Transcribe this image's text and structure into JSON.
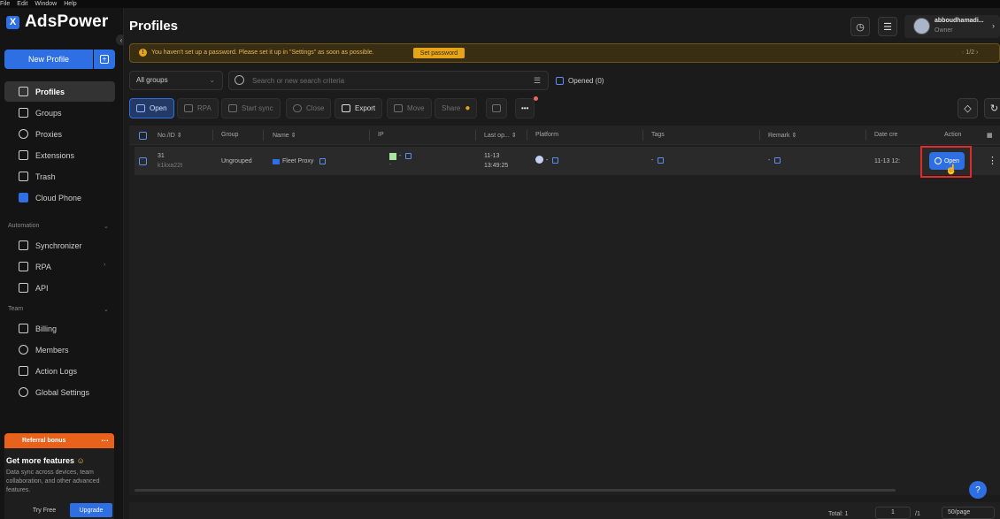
{
  "menubar": [
    "File",
    "Edit",
    "Window",
    "Help"
  ],
  "app": {
    "name": "AdsPower",
    "logo_mark": "X"
  },
  "sidebar": {
    "new_profile": "New Profile",
    "items": [
      {
        "label": "Profiles",
        "icon": "profiles-icon",
        "active": true
      },
      {
        "label": "Groups",
        "icon": "groups-icon"
      },
      {
        "label": "Proxies",
        "icon": "proxies-icon"
      },
      {
        "label": "Extensions",
        "icon": "extensions-icon"
      },
      {
        "label": "Trash",
        "icon": "trash-icon"
      },
      {
        "label": "Cloud Phone",
        "icon": "cloud-phone-icon"
      }
    ],
    "automation_label": "Automation",
    "automation_items": [
      {
        "label": "Synchronizer",
        "icon": "synchronizer-icon"
      },
      {
        "label": "RPA",
        "icon": "rpa-icon"
      },
      {
        "label": "API",
        "icon": "api-icon"
      }
    ],
    "team_label": "Team",
    "team_items": [
      {
        "label": "Billing",
        "icon": "billing-icon"
      },
      {
        "label": "Members",
        "icon": "members-icon"
      },
      {
        "label": "Action Logs",
        "icon": "action-logs-icon"
      },
      {
        "label": "Global Settings",
        "icon": "global-settings-icon"
      }
    ],
    "referral": "Referral bonus",
    "promo_title": "Get more features",
    "promo_desc": "Data sync across devices, team collaboration, and other advanced features.",
    "try_free": "Try Free",
    "upgrade": "Upgrade"
  },
  "header": {
    "title": "Profiles",
    "user_name": "abboudhamadi...",
    "user_role": "Owner"
  },
  "banner": {
    "text": "You haven't set up a password. Please set it up in \"Settings\" as soon as possible.",
    "button": "Set password",
    "page": "1/2"
  },
  "filters": {
    "group_select": "All groups",
    "search_placeholder": "Search or new search criteria",
    "opened_label": "Opened (0)"
  },
  "toolbar": {
    "open": "Open",
    "rpa": "RPA",
    "start_sync": "Start sync",
    "close": "Close",
    "export": "Export",
    "move": "Move",
    "share": "Share",
    "more": "•••"
  },
  "table": {
    "columns": [
      "No./ID ⇕",
      "Group",
      "Name ⇕",
      "IP",
      "Last op... ⇕",
      "Platform",
      "Tags",
      "Remark ⇕",
      "Date cre",
      "Action"
    ],
    "rows": [
      {
        "no": "31",
        "id": "k1kxa22t",
        "group": "Ungrouped",
        "name": "Fleet Proxy",
        "ip_dash": "-",
        "ip_sub": "-",
        "last_date": "11-13",
        "last_time": "13:49:25",
        "platform_dash": "-",
        "tags": "-",
        "remark": "-",
        "date": "11-13 12:",
        "action": "Open"
      }
    ]
  },
  "footer": {
    "total": "Total: 1",
    "page": "1",
    "pages": "/1",
    "per_page": "50/page"
  }
}
